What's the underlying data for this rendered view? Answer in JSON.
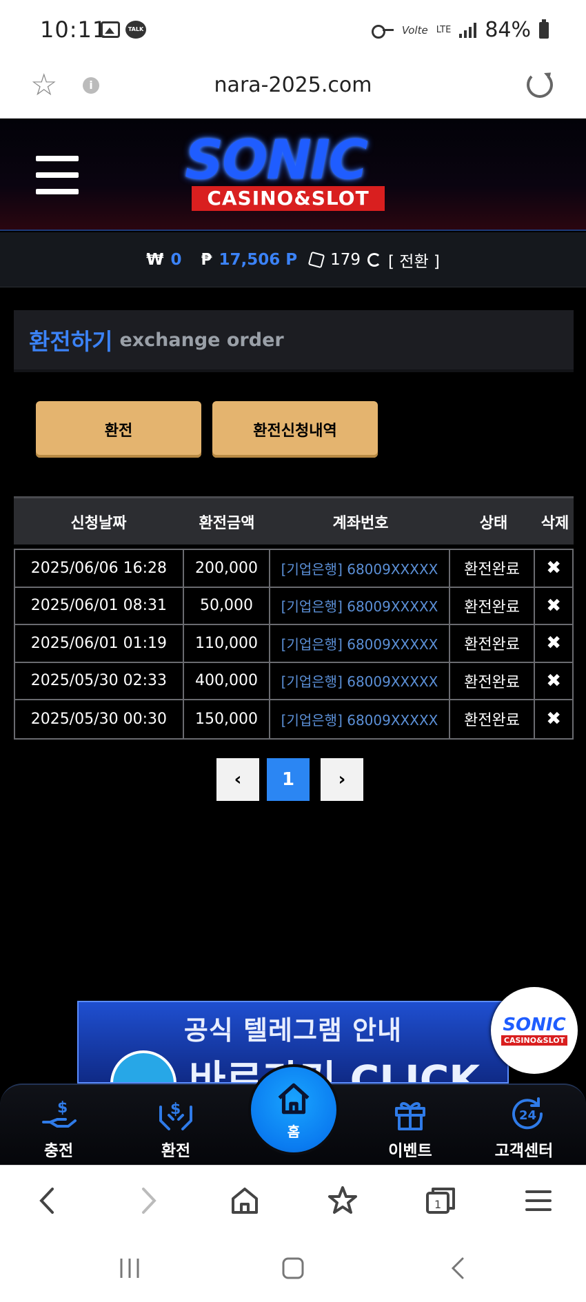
{
  "status_bar": {
    "time": "10:11",
    "talk_label": "TALK",
    "volte": "Volte",
    "lte": "LTE",
    "battery": "84%"
  },
  "browser": {
    "url": "nara-2025.com"
  },
  "site": {
    "logo_main": "SONIC",
    "logo_sub": "CASINO&SLOT"
  },
  "balance": {
    "won_symbol": "₩",
    "won_value": "0",
    "point_symbol": "₱",
    "point_value": "17,506 P",
    "chips_value": "179",
    "convert_label": "[ 전환 ]"
  },
  "section": {
    "title_kr": "환전하기",
    "title_en": "exchange order"
  },
  "buttons": {
    "exchange": "환전",
    "history": "환전신청내역"
  },
  "table": {
    "headers": [
      "신청날짜",
      "환전금액",
      "계좌번호",
      "상태",
      "삭제"
    ],
    "rows": [
      {
        "date": "2025/06/06 16:28",
        "amount": "200,000",
        "account": "[기업은행] 68009XXXXX",
        "status": "환전완료",
        "delete": "✖"
      },
      {
        "date": "2025/06/01 08:31",
        "amount": "50,000",
        "account": "[기업은행] 68009XXXXX",
        "status": "환전완료",
        "delete": "✖"
      },
      {
        "date": "2025/06/01 01:19",
        "amount": "110,000",
        "account": "[기업은행] 68009XXXXX",
        "status": "환전완료",
        "delete": "✖"
      },
      {
        "date": "2025/05/30 02:33",
        "amount": "400,000",
        "account": "[기업은행] 68009XXXXX",
        "status": "환전완료",
        "delete": "✖"
      },
      {
        "date": "2025/05/30 00:30",
        "amount": "150,000",
        "account": "[기업은행] 68009XXXXX",
        "status": "환전완료",
        "delete": "✖"
      }
    ]
  },
  "pagination": {
    "prev": "‹",
    "current": "1",
    "next": "›"
  },
  "banner": {
    "title": "공식 텔레그램 안내",
    "cta": "바로가기 CLICK"
  },
  "floating_logo": {
    "main": "SONIC",
    "sub": "CASINO&SLOT"
  },
  "bottom_nav": {
    "deposit": "충전",
    "withdraw": "환전",
    "home": "홈",
    "event": "이벤트",
    "support": "고객센터",
    "accent_color": "#2f7be8"
  }
}
